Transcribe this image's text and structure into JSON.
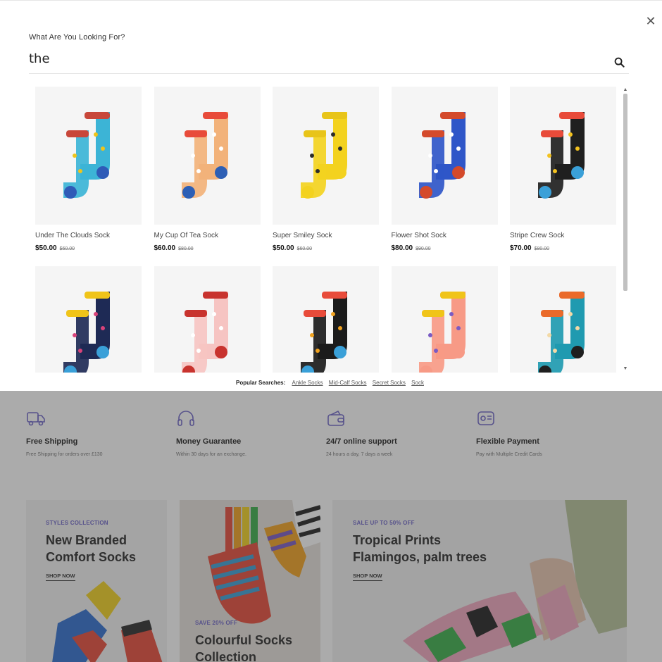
{
  "search": {
    "label": "What Are You Looking For?",
    "value": "the"
  },
  "products": [
    {
      "name": "Under The Clouds Sock",
      "price": "$50.00",
      "old_price": "$60.00",
      "colors": [
        "#3cb4d6",
        "#c8473a",
        "#f0c419",
        "#2f5bb7"
      ]
    },
    {
      "name": "My Cup Of Tea Sock",
      "price": "$60.00",
      "old_price": "$80.00",
      "colors": [
        "#f2b27a",
        "#e84b3a",
        "#ffffff",
        "#2d5fb5"
      ]
    },
    {
      "name": "Super Smiley Sock",
      "price": "$50.00",
      "old_price": "$60.00",
      "colors": [
        "#f3d21f",
        "#e8c419",
        "#2b2b2b",
        "#f3d21f"
      ]
    },
    {
      "name": "Flower Shot Sock",
      "price": "$80.00",
      "old_price": "$90.00",
      "colors": [
        "#2f56c8",
        "#d44a2b",
        "#ffffff",
        "#d44a2b"
      ]
    },
    {
      "name": "Stripe Crew Sock",
      "price": "$70.00",
      "old_price": "$80.00",
      "colors": [
        "#1f1f1f",
        "#e84b3a",
        "#f3c21f",
        "#3aa0d8"
      ]
    },
    {
      "name": "",
      "price": "",
      "old_price": "",
      "colors": [
        "#1e2a55",
        "#f0c419",
        "#d8437a",
        "#3aa0d8"
      ]
    },
    {
      "name": "",
      "price": "",
      "old_price": "",
      "colors": [
        "#f6c4c2",
        "#c8332e",
        "#ffffff",
        "#c8332e"
      ]
    },
    {
      "name": "",
      "price": "",
      "old_price": "",
      "colors": [
        "#1b1b1b",
        "#e84b3a",
        "#f0a21f",
        "#3aa0d8"
      ]
    },
    {
      "name": "",
      "price": "",
      "old_price": "",
      "colors": [
        "#f79a86",
        "#f0c419",
        "#7a5bc4",
        "#f79a86"
      ]
    },
    {
      "name": "",
      "price": "",
      "old_price": "",
      "colors": [
        "#1f9ab0",
        "#ea6a2a",
        "#f3d9a6",
        "#1f1f1f"
      ]
    }
  ],
  "popular": {
    "label": "Popular Searches:",
    "links": [
      "Ankle Socks",
      "Mid-Calf Socks",
      "Secret Socks",
      "Sock"
    ]
  },
  "features": [
    {
      "icon": "truck-icon",
      "title": "Free Shipping",
      "text": "Free Shipping for orders over £130"
    },
    {
      "icon": "headphones-icon",
      "title": "Money Guarantee",
      "text": "Within 30 days for an exchange."
    },
    {
      "icon": "wallet-icon",
      "title": "24/7 online support",
      "text": "24 hours a day, 7 days a week"
    },
    {
      "icon": "payment-icon",
      "title": "Flexible Payment",
      "text": "Pay with Multiple Credit Cards"
    }
  ],
  "banners": [
    {
      "tag": "STYLES COLLECTION",
      "title_line1": "New Branded",
      "title_line2": "Comfort Socks",
      "cta": "SHOP NOW"
    },
    {
      "tag": "SAVE 20% OFF",
      "title_line1": "Colourful Socks",
      "title_line2": "Collection"
    },
    {
      "tag": "SALE UP TO 50% OFF",
      "title_line1": "Tropical Prints",
      "title_line2": "Flamingos, palm trees",
      "cta": "SHOP NOW"
    }
  ],
  "accent_color": "#6e66c9"
}
